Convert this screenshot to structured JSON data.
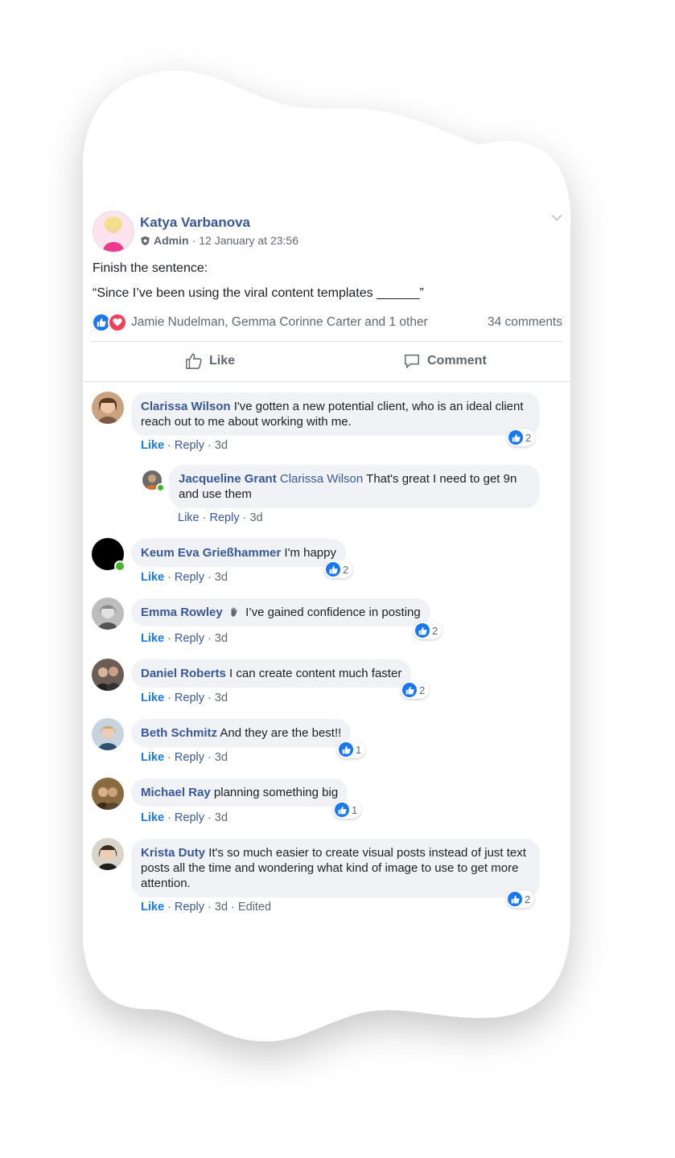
{
  "post": {
    "author": "Katya Varbanova",
    "role": "Admin",
    "timestamp": "12 January at 23:56",
    "text_line1": "Finish the sentence:",
    "text_line2": "“Since I’ve been using the viral content templates ______”",
    "reactors": "Jamie Nudelman, Gemma Corinne Carter and 1 other",
    "comment_count": "34 comments",
    "like_label": "Like",
    "comment_label": "Comment",
    "reaction_icons": [
      "like-icon",
      "love-icon"
    ]
  },
  "comments": [
    {
      "name": "Clarissa Wilson",
      "text": "I've gotten a new potential client, who is an ideal client reach out to me about working with me.",
      "like": "Like",
      "reply": "Reply",
      "time": "3d",
      "likes": "2",
      "reply_comment": {
        "name": "Jacqueline Grant",
        "tag": "Clarissa Wilson",
        "text": "That's great I need to get 9n and use them",
        "like": "Like",
        "reply": "Reply",
        "time": "3d"
      }
    },
    {
      "name": "Keum Eva Grießhammer",
      "text": "I'm happy",
      "like": "Like",
      "reply": "Reply",
      "time": "3d",
      "likes": "2"
    },
    {
      "name": "Emma Rowley",
      "badge_icon": "wave-hand-icon",
      "text": "I’ve gained confidence in posting",
      "like": "Like",
      "reply": "Reply",
      "time": "3d",
      "likes": "2"
    },
    {
      "name": "Daniel Roberts",
      "text": "I can create content much faster",
      "like": "Like",
      "reply": "Reply",
      "time": "3d",
      "likes": "2"
    },
    {
      "name": "Beth Schmitz",
      "text": "And they are the best!!",
      "like": "Like",
      "reply": "Reply",
      "time": "3d",
      "likes": "1"
    },
    {
      "name": "Michael Ray",
      "text": "planning something big",
      "like": "Like",
      "reply": "Reply",
      "time": "3d",
      "likes": "1"
    },
    {
      "name": "Krista Duty",
      "text": "It's so much easier to create visual posts instead of just text posts all the time and wondering what kind of image to use to get more attention.",
      "like": "Like",
      "reply": "Reply",
      "time": "3d",
      "edited": "Edited",
      "likes": "2"
    }
  ],
  "colors": {
    "link_blue": "#385898",
    "like_blue": "#1877f2",
    "love_red": "#f33e58",
    "bubble_gray": "#f0f2f5",
    "online_green": "#42b72a"
  }
}
